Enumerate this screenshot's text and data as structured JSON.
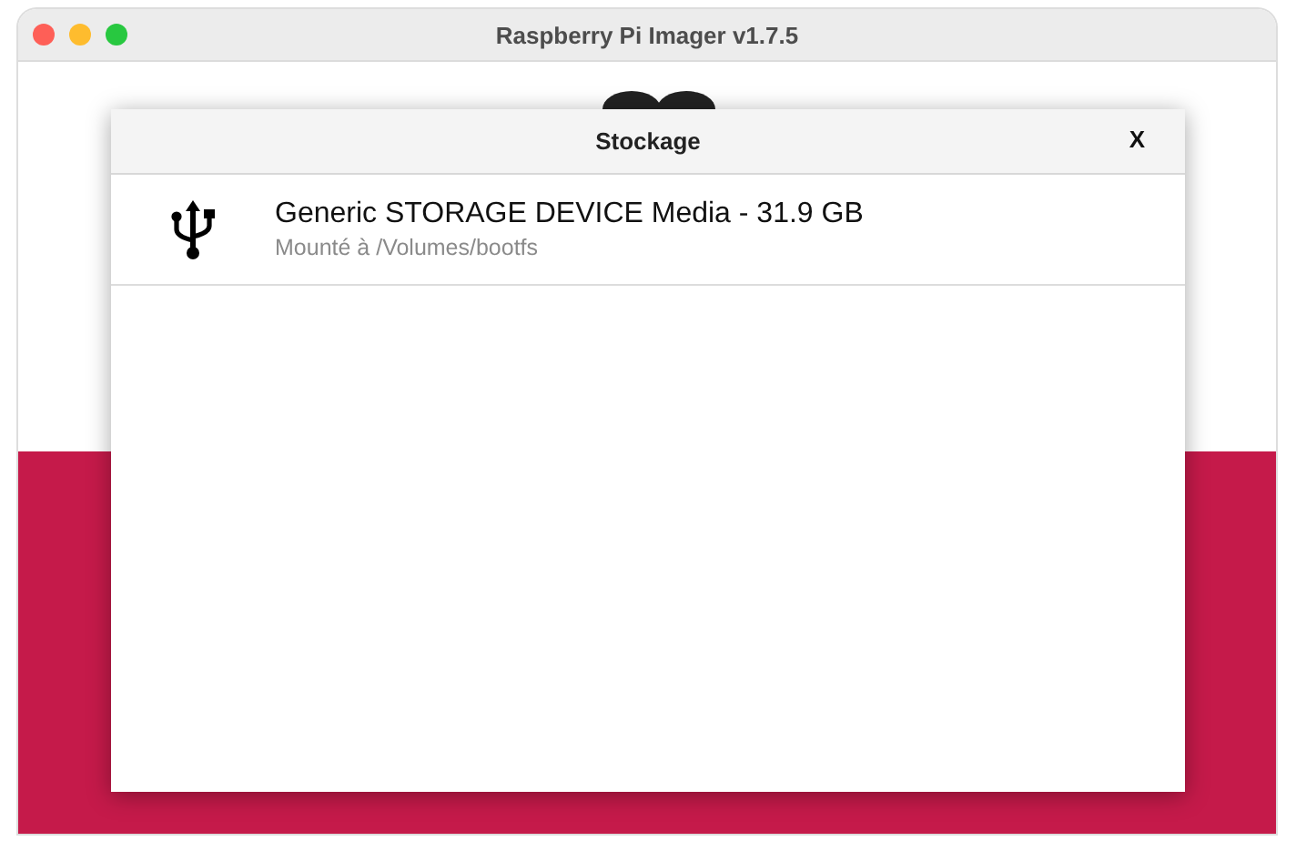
{
  "window": {
    "title": "Raspberry Pi Imager v1.7.5"
  },
  "dialog": {
    "title": "Stockage",
    "close": "X",
    "devices": [
      {
        "name": "Generic STORAGE DEVICE Media - 31.9 GB",
        "mount": "Mounté à /Volumes/bootfs"
      }
    ]
  }
}
